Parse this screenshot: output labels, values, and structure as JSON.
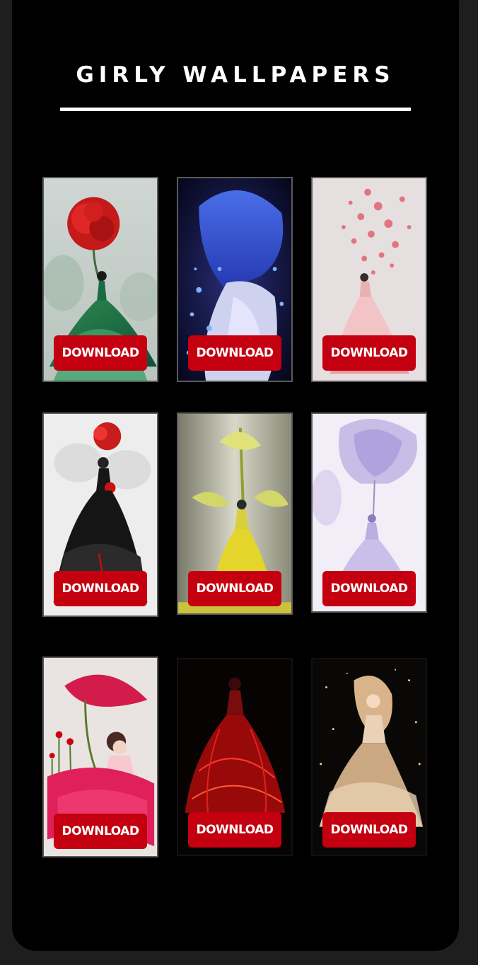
{
  "header": {
    "title": "GIRLY WALLPAPERS"
  },
  "wallpapers": [
    {
      "theme": "red-rose-green-gown",
      "button_label": "DOWNLOAD"
    },
    {
      "theme": "blue-butterfly-girl",
      "button_label": "DOWNLOAD"
    },
    {
      "theme": "pink-petals-dress",
      "button_label": "DOWNLOAD"
    },
    {
      "theme": "black-gown-red-rose",
      "button_label": "DOWNLOAD"
    },
    {
      "theme": "yellow-lily-dress",
      "button_label": "DOWNLOAD"
    },
    {
      "theme": "lavender-tulip-dress",
      "button_label": "DOWNLOAD"
    },
    {
      "theme": "pink-poppy-girl",
      "button_label": "DOWNLOAD"
    },
    {
      "theme": "red-glowing-dress",
      "button_label": "DOWNLOAD"
    },
    {
      "theme": "golden-sparkle-gown",
      "button_label": "DOWNLOAD"
    }
  ],
  "colors": {
    "button": "#c40010",
    "background": "#000000",
    "frame": "#1e1e1e"
  }
}
